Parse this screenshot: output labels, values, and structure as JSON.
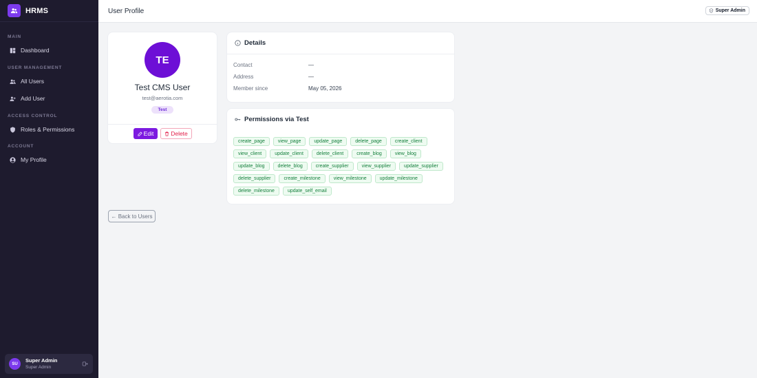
{
  "app": {
    "name": "HRMS"
  },
  "sidebar": {
    "sections": [
      {
        "label": "MAIN"
      },
      {
        "label": "USER MANAGEMENT"
      },
      {
        "label": "ACCESS CONTROL"
      },
      {
        "label": "ACCOUNT"
      }
    ],
    "items": [
      {
        "label": "Dashboard",
        "icon": "dashboard-icon"
      },
      {
        "label": "All Users",
        "icon": "users-icon"
      },
      {
        "label": "Add User",
        "icon": "user-plus-icon"
      },
      {
        "label": "Roles & Permissions",
        "icon": "shield-icon"
      },
      {
        "label": "My Profile",
        "icon": "user-circle-icon"
      }
    ],
    "current_user": {
      "initials": "SU",
      "name": "Super Admin",
      "role": "Super Admin"
    }
  },
  "header": {
    "title": "User Profile",
    "role_badge": "Super Admin"
  },
  "profile": {
    "initials": "TE",
    "name": "Test CMS User",
    "email": "test@aerotia.com",
    "role": "Test",
    "edit_label": "Edit",
    "delete_label": "Delete"
  },
  "details": {
    "title": "Details",
    "rows": [
      {
        "label": "Contact",
        "value": "—"
      },
      {
        "label": "Address",
        "value": "—"
      },
      {
        "label": "Member since",
        "value": "May 05, 2026"
      }
    ]
  },
  "permissions": {
    "title": "Permissions via Test",
    "items": [
      "create_page",
      "view_page",
      "update_page",
      "delete_page",
      "create_client",
      "view_client",
      "update_client",
      "delete_client",
      "create_blog",
      "view_blog",
      "update_blog",
      "delete_blog",
      "create_supplier",
      "view_supplier",
      "update_supplier",
      "delete_supplier",
      "create_milestone",
      "view_milestone",
      "update_milestone",
      "delete_milestone",
      "update_self_email"
    ]
  },
  "back_label": "← Back to Users",
  "colors": {
    "sidebar": "#1e1b2e",
    "accent": "#7c3aed",
    "danger": "#e11d48",
    "success": "#15803d"
  }
}
